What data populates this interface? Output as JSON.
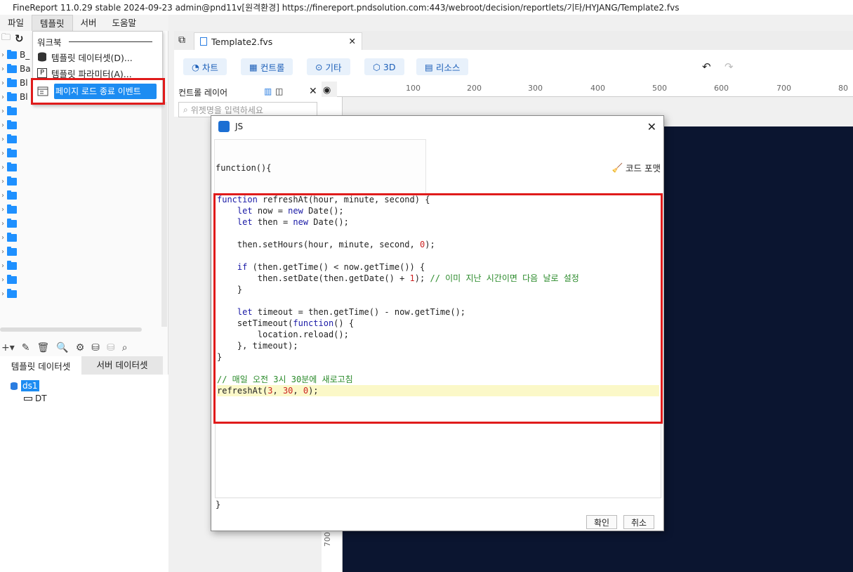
{
  "window": {
    "title": "FineReport 11.0.29 stable 2024-09-23 admin@pnd11v[원격환경]    https://finereport.pndsolution.com:443/webroot/decision/reportlets/기타/HYJANG/Template2.fvs"
  },
  "menubar": [
    {
      "label": "파일"
    },
    {
      "label": "템플릿",
      "active": true
    },
    {
      "label": "서버"
    },
    {
      "label": "도움말"
    }
  ],
  "folder_tree": {
    "items": [
      "B_",
      "Ba",
      "Bl",
      "Bl",
      "",
      "",
      "",
      "",
      "",
      "",
      "",
      "",
      "",
      "",
      "",
      "",
      "",
      ""
    ]
  },
  "dropdown": {
    "section": "워크북",
    "items": [
      {
        "label": "템플릿 데이터셋(D)...",
        "icon": "database-icon"
      },
      {
        "label": "템플릿 파라미터(A)...",
        "icon": "parameter-icon"
      },
      {
        "label": "페이지 로드 종료 이벤트",
        "icon": "page-event-icon",
        "selected": true
      }
    ]
  },
  "datasets": {
    "tabs": [
      "템플릿 데이터셋",
      "서버 데이터셋"
    ],
    "tree": [
      {
        "label": "ds1"
      },
      {
        "label": "DT"
      }
    ]
  },
  "doc_tab": {
    "label": "Template2.fvs"
  },
  "toolbar": {
    "buttons": [
      {
        "label": "차트",
        "icon": "chart-icon"
      },
      {
        "label": "컨트롤",
        "icon": "control-icon"
      },
      {
        "label": "기타",
        "icon": "more-icon"
      },
      {
        "label": "3D",
        "icon": "cube-icon"
      },
      {
        "label": "리소스",
        "icon": "resource-icon"
      }
    ]
  },
  "layer_panel": {
    "title": "컨트롤 레이어",
    "search_placeholder": "위젯명을 입력하세요"
  },
  "ruler": {
    "h_labels": [
      "100",
      "200",
      "300",
      "400",
      "500",
      "600",
      "700",
      "80"
    ],
    "v_label": "700"
  },
  "dialog": {
    "title": "JS",
    "fn_open": "function(){",
    "fn_close": "}",
    "code_format_label": "코드 포맷",
    "ok_label": "확인",
    "cancel_label": "취소",
    "code_lines": [
      "function refreshAt(hour, minute, second) {",
      "    let now = new Date();",
      "    let then = new Date();",
      "",
      "    then.setHours(hour, minute, second, 0);",
      "",
      "    if (then.getTime() < now.getTime()) {",
      "        then.setDate(then.getDate() + 1); // 이미 지난 시간이면 다음 날로 설정",
      "    }",
      "",
      "    let timeout = then.getTime() - now.getTime();",
      "    setTimeout(function() {",
      "        location.reload();",
      "    }, timeout);",
      "}",
      "",
      "// 매일 오전 3시 30분에 새로고침",
      "refreshAt(3, 30, 0);"
    ],
    "highlighted_line": 17
  },
  "colors": {
    "accent": "#1c8cf2",
    "highlight_red": "#e01b1b",
    "canvas": "#0b1530"
  }
}
